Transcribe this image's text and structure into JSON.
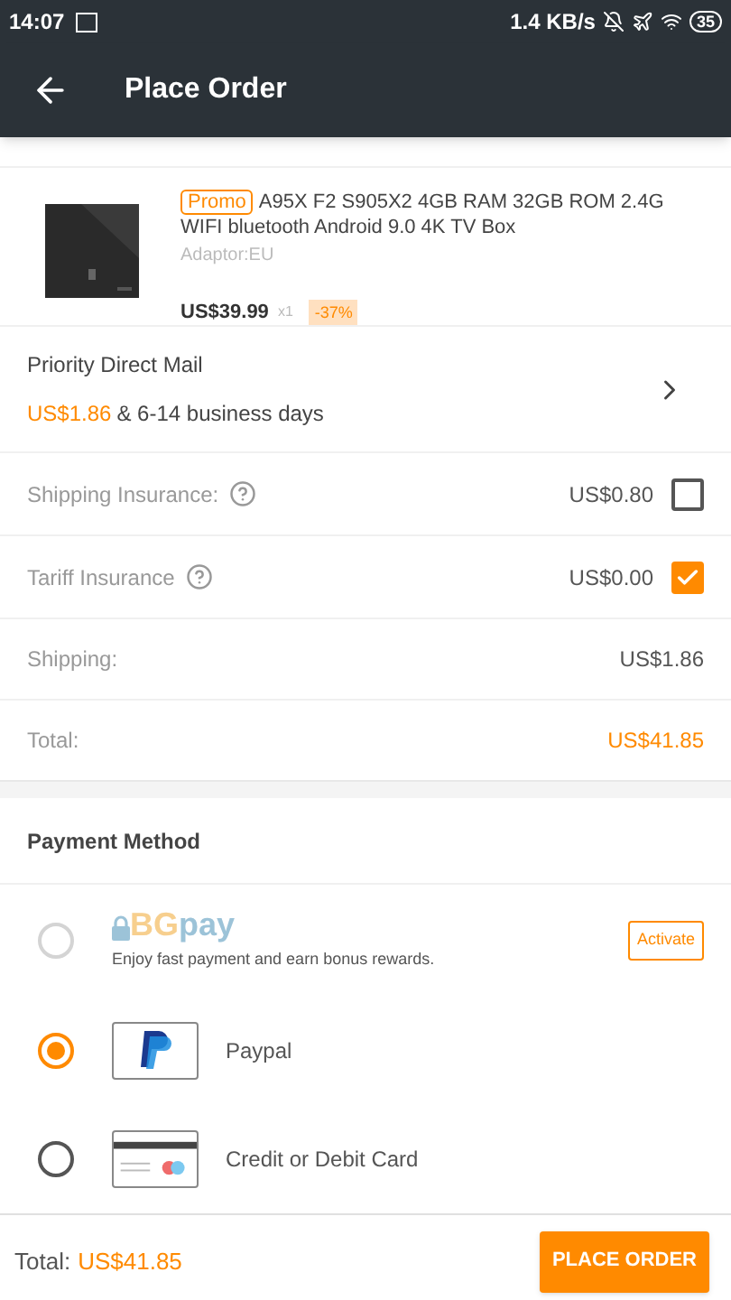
{
  "status_bar": {
    "time": "14:07",
    "speed": "1.4 KB/s",
    "battery": "35"
  },
  "header": {
    "title": "Place Order"
  },
  "product": {
    "badge": "Promo",
    "name": "A95X F2 S905X2 4GB RAM 32GB ROM 2.4G WIFI bluetooth Android 9.0 4K TV Box",
    "variant": "Adaptor:EU",
    "price": "US$39.99",
    "quantity": "x1",
    "discount": "-37%"
  },
  "shipping_method": {
    "name": "Priority Direct Mail",
    "price": "US$1.86",
    "time": "& 6-14 business days"
  },
  "options": [
    {
      "label": "Shipping Insurance:",
      "price": "US$0.80",
      "checked": false
    },
    {
      "label": "Tariff Insurance",
      "price": "US$0.00",
      "checked": true
    }
  ],
  "summary": [
    {
      "kind": "plain",
      "label": "Shipping:",
      "value": "US$1.86"
    },
    {
      "kind": "total",
      "label": "Total:",
      "value": "US$41.85"
    }
  ],
  "payment": {
    "title": "Payment Method",
    "methods": [
      {
        "kind": "wallet",
        "logo_a": "BG",
        "logo_b": "pay",
        "description": "Enjoy fast payment and earn bonus rewards.",
        "action": "Activate",
        "selected": false,
        "disabled": true
      },
      {
        "kind": "paypal",
        "label": "Paypal",
        "selected": true,
        "disabled": false
      },
      {
        "kind": "card",
        "label": "Credit or Debit Card",
        "selected": false,
        "disabled": false
      }
    ]
  },
  "footer": {
    "total_label": "Total:",
    "total": "US$41.85",
    "button": "PLACE ORDER"
  }
}
